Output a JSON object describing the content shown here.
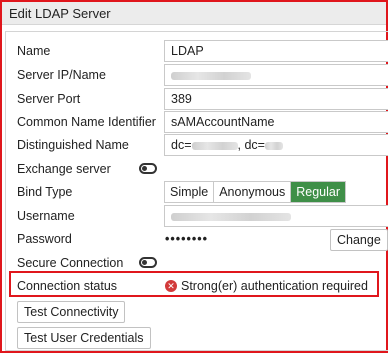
{
  "dialog": {
    "title": "Edit LDAP Server"
  },
  "labels": {
    "name": "Name",
    "server_ip": "Server IP/Name",
    "server_port": "Server Port",
    "cn_identifier": "Common Name Identifier",
    "distinguished_name": "Distinguished Name",
    "exchange_server": "Exchange server",
    "bind_type": "Bind Type",
    "username": "Username",
    "password": "Password",
    "secure_connection": "Secure Connection",
    "connection_status": "Connection status"
  },
  "values": {
    "name": "LDAP",
    "server_port": "389",
    "cn_identifier": "sAMAccountName",
    "dn_prefix": "dc=",
    "dn_middle": ", dc=",
    "password_mask": "••••••••"
  },
  "toggles": {
    "exchange_server": false,
    "secure_connection": false
  },
  "bind_type": {
    "options": [
      "Simple",
      "Anonymous",
      "Regular"
    ],
    "selected": "Regular"
  },
  "buttons": {
    "change": "Change",
    "test_connectivity": "Test Connectivity",
    "test_user_credentials": "Test User Credentials"
  },
  "status": {
    "message": "Strong(er) authentication required",
    "icon": "error-circle-icon",
    "icon_glyph": "✕",
    "color": "#d23a3a"
  },
  "colors": {
    "highlight_border": "#e0161c",
    "active_segment": "#3f8f48"
  }
}
